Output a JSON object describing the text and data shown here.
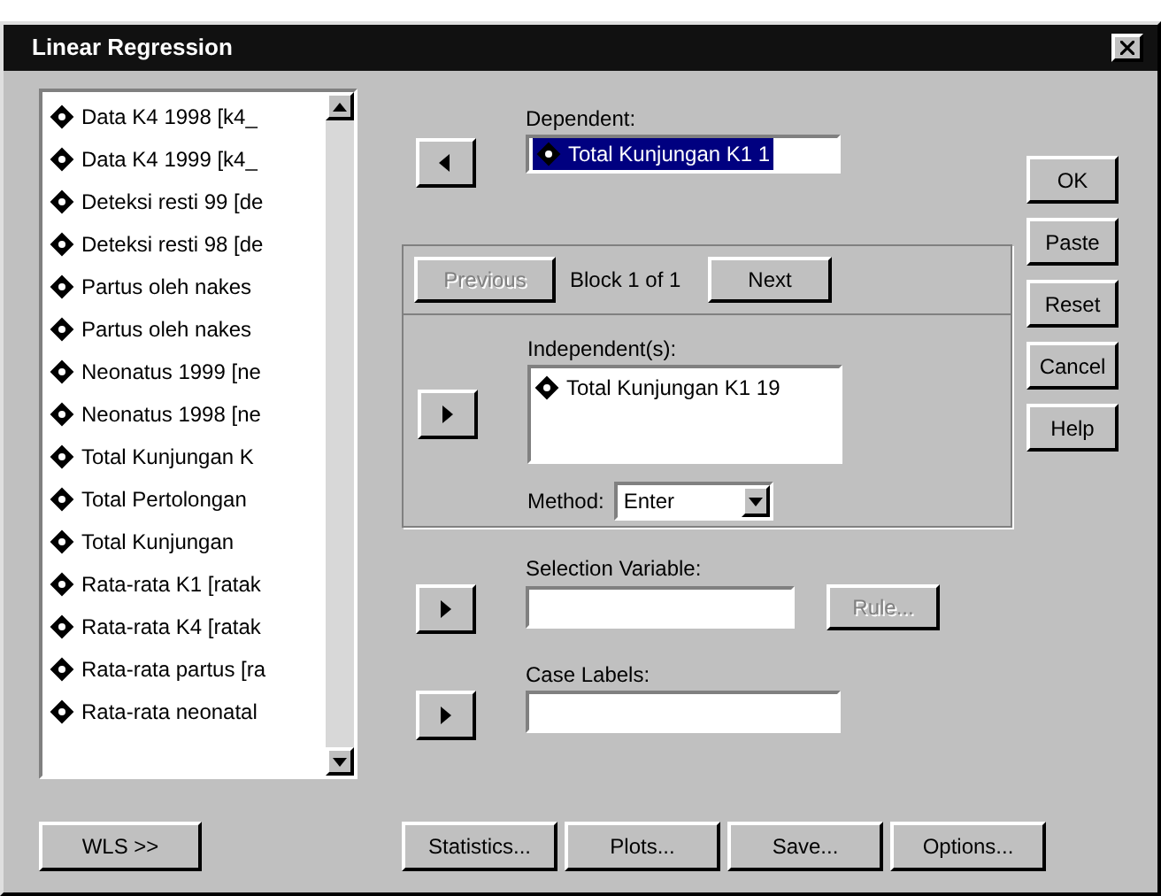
{
  "window": {
    "title": "Linear Regression"
  },
  "variables": [
    {
      "label": "Data K4 1998 [k4_"
    },
    {
      "label": "Data K4 1999 [k4_"
    },
    {
      "label": "Deteksi resti 99 [de"
    },
    {
      "label": "Deteksi resti 98 [de"
    },
    {
      "label": "Partus oleh nakes"
    },
    {
      "label": "Partus oleh nakes"
    },
    {
      "label": "Neonatus 1999 [ne"
    },
    {
      "label": "Neonatus 1998 [ne"
    },
    {
      "label": "Total Kunjungan K"
    },
    {
      "label": "Total Pertolongan"
    },
    {
      "label": "Total Kunjungan"
    },
    {
      "label": "Rata-rata K1 [ratak"
    },
    {
      "label": "Rata-rata K4 [ratak"
    },
    {
      "label": "Rata-rata partus [ra"
    },
    {
      "label": "Rata-rata neonatal"
    }
  ],
  "dependent": {
    "label": "Dependent:",
    "arrow_button": {
      "kind": "left"
    },
    "value": "Total Kunjungan K1 1",
    "selected": true
  },
  "block": {
    "previous": {
      "label": "Previous",
      "disabled": true
    },
    "label": "Block 1 of 1",
    "next": {
      "label": "Next",
      "disabled": false
    }
  },
  "independents": {
    "label": "Independent(s):",
    "arrow_button": {
      "kind": "right"
    },
    "items": [
      "Total Kunjungan K1 19"
    ]
  },
  "method": {
    "label": "Method:",
    "value": "Enter"
  },
  "selection_variable": {
    "label": "Selection Variable:",
    "arrow_button": {
      "kind": "right"
    },
    "rule": {
      "label": "Rule...",
      "disabled": true
    }
  },
  "case_labels": {
    "label": "Case Labels:",
    "arrow_button": {
      "kind": "right"
    }
  },
  "side_buttons": [
    "OK",
    "Paste",
    "Reset",
    "Cancel",
    "Help"
  ],
  "wls_button": "WLS >>",
  "bottom_buttons": [
    "Statistics...",
    "Plots...",
    "Save...",
    "Options..."
  ]
}
